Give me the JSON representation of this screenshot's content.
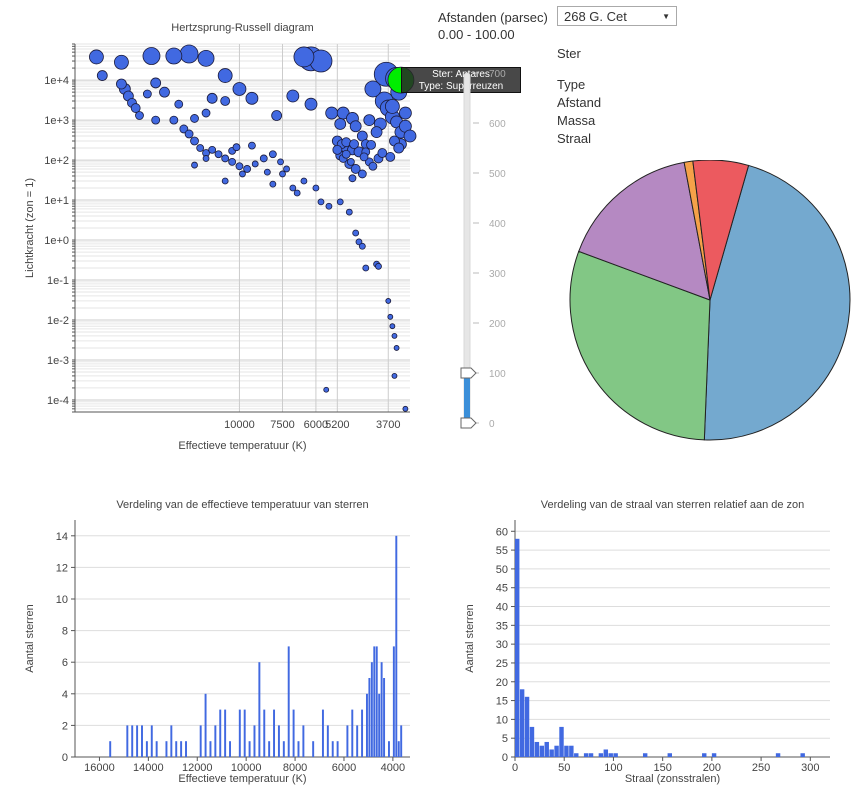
{
  "hr": {
    "title": "Hertzsprung-Russell diagram",
    "xlabel": "Effectieve temperatuur (K)",
    "ylabel": "Lichtkracht (zon = 1)",
    "xticks": [
      "10000",
      "7500",
      "6000",
      "5200",
      "3700"
    ],
    "yticks": [
      "1e+4",
      "1e+3",
      "1e+2",
      "1e+1",
      "1e+0",
      "1e-1",
      "1e-2",
      "1e-3",
      "1e-4"
    ],
    "tooltip": {
      "line1": "Ster: Antares",
      "line2": "Type: Superreuzen"
    },
    "highlight_color": "#00ee00",
    "point_color": "#4169e1"
  },
  "controls": {
    "distance_label": "Afstanden (parsec)",
    "distance_range": "0.00 - 100.00",
    "select_value": "268 G. Cet",
    "slider_ticks": [
      "700",
      "600",
      "500",
      "400",
      "300",
      "200",
      "100",
      "0"
    ],
    "range": [
      0,
      100
    ]
  },
  "info": {
    "star_label": "Ster",
    "type_label": "Type",
    "distance_label": "Afstand",
    "mass_label": "Massa",
    "radius_label": "Straal"
  },
  "chart_data": [
    {
      "type": "scatter",
      "title": "Hertzsprung-Russell diagram",
      "xlabel": "Effectieve temperatuur (K)",
      "ylabel": "Lichtkracht (zon = 1)",
      "scale": "log-log",
      "xlim": [
        30000,
        3200
      ],
      "ylim": [
        5e-05,
        80000
      ],
      "points": [
        [
          25000,
          13000,
          5
        ],
        [
          22000,
          8000,
          5
        ],
        [
          21000,
          4000,
          5
        ],
        [
          20500,
          2700,
          4.5
        ],
        [
          20000,
          2000,
          4.5
        ],
        [
          21500,
          6000,
          5.5
        ],
        [
          18500,
          4500,
          4
        ],
        [
          17500,
          8500,
          5
        ],
        [
          16500,
          5000,
          5
        ],
        [
          19500,
          1300,
          4
        ],
        [
          17500,
          1000,
          4
        ],
        [
          15500,
          1000,
          4
        ],
        [
          15000,
          2500,
          4
        ],
        [
          13500,
          1100,
          4
        ],
        [
          12500,
          1500,
          4
        ],
        [
          12000,
          3500,
          5
        ],
        [
          11000,
          3000,
          4.5
        ],
        [
          14500,
          600,
          4
        ],
        [
          14000,
          450,
          4
        ],
        [
          13500,
          300,
          4
        ],
        [
          13000,
          200,
          3.5
        ],
        [
          12500,
          150,
          3.5
        ],
        [
          12000,
          180,
          3.5
        ],
        [
          11500,
          140,
          3.5
        ],
        [
          11000,
          110,
          3.5
        ],
        [
          10500,
          90,
          3.5
        ],
        [
          10000,
          70,
          3.5
        ],
        [
          10500,
          170,
          3.5
        ],
        [
          9500,
          60,
          3.5
        ],
        [
          9000,
          80,
          3
        ],
        [
          8500,
          110,
          3.5
        ],
        [
          8300,
          50,
          3
        ],
        [
          8000,
          25,
          3
        ],
        [
          7500,
          45,
          3
        ],
        [
          7000,
          20,
          3
        ],
        [
          6800,
          15,
          3
        ],
        [
          9800,
          45,
          3
        ],
        [
          11000,
          30,
          3
        ],
        [
          12500,
          110,
          3
        ],
        [
          13500,
          75,
          3
        ],
        [
          10200,
          210,
          3.5
        ],
        [
          9200,
          230,
          3.5
        ],
        [
          8000,
          140,
          3.5
        ],
        [
          7600,
          90,
          3
        ],
        [
          7300,
          60,
          3
        ],
        [
          6500,
          30,
          3
        ],
        [
          6000,
          20,
          3
        ],
        [
          5800,
          9,
          3
        ],
        [
          5500,
          7,
          3
        ],
        [
          5100,
          9,
          3
        ],
        [
          4800,
          5,
          3
        ],
        [
          4600,
          1.5,
          3
        ],
        [
          4500,
          0.9,
          3
        ],
        [
          4400,
          0.7,
          3
        ],
        [
          4300,
          0.2,
          3
        ],
        [
          4000,
          0.25,
          3
        ],
        [
          3950,
          0.22,
          3
        ],
        [
          3700,
          0.03,
          2.5
        ],
        [
          3650,
          0.012,
          2.5
        ],
        [
          3600,
          0.007,
          2.5
        ],
        [
          3550,
          0.004,
          2.5
        ],
        [
          3500,
          0.002,
          2.5
        ],
        [
          3550,
          0.0004,
          2.5
        ],
        [
          3300,
          6e-05,
          2.5
        ],
        [
          5600,
          0.00018,
          2.5
        ],
        [
          26000,
          38000,
          7
        ],
        [
          22000,
          28000,
          7
        ],
        [
          18000,
          40000,
          8.5
        ],
        [
          14000,
          45000,
          9
        ],
        [
          15500,
          40000,
          8
        ],
        [
          12500,
          35000,
          8
        ],
        [
          11000,
          13000,
          7
        ],
        [
          10000,
          6000,
          6.5
        ],
        [
          9200,
          3500,
          6
        ],
        [
          7800,
          1300,
          5
        ],
        [
          7000,
          4000,
          6
        ],
        [
          6200,
          2500,
          6
        ],
        [
          6500,
          38000,
          10
        ],
        [
          6200,
          34000,
          12
        ],
        [
          5800,
          30000,
          11
        ],
        [
          5400,
          1500,
          6
        ],
        [
          5100,
          800,
          5.5
        ],
        [
          5000,
          1500,
          6
        ],
        [
          4700,
          1100,
          6
        ],
        [
          4600,
          700,
          5.5
        ],
        [
          4400,
          400,
          5
        ],
        [
          4200,
          1000,
          5.5
        ],
        [
          4000,
          500,
          5.5
        ],
        [
          3900,
          800,
          6
        ],
        [
          4100,
          6000,
          8
        ],
        [
          3800,
          3000,
          9
        ],
        [
          3700,
          2000,
          8
        ],
        [
          3600,
          1200,
          7
        ],
        [
          3500,
          900,
          6
        ],
        [
          3400,
          500,
          6
        ],
        [
          3300,
          700,
          6
        ],
        [
          3750,
          14000,
          12
        ],
        [
          3500,
          11000,
          11
        ],
        [
          3450,
          5000,
          8
        ],
        [
          3600,
          2200,
          7
        ],
        [
          3300,
          1500,
          6
        ],
        [
          3200,
          400,
          6
        ],
        [
          3400,
          250,
          5.5
        ],
        [
          4900,
          200,
          5
        ],
        [
          4700,
          180,
          5
        ],
        [
          4500,
          160,
          5
        ],
        [
          5100,
          130,
          4.5
        ],
        [
          4800,
          80,
          4.5
        ],
        [
          4600,
          60,
          4.5
        ],
        [
          4400,
          45,
          4
        ],
        [
          4200,
          90,
          4
        ],
        [
          4100,
          70,
          4
        ],
        [
          3950,
          110,
          4.5
        ],
        [
          3850,
          150,
          4.5
        ],
        [
          3650,
          120,
          4.5
        ],
        [
          3550,
          300,
          5
        ],
        [
          3450,
          200,
          5
        ],
        [
          5200,
          300,
          5
        ],
        [
          5050,
          250,
          4.5
        ],
        [
          4900,
          280,
          4.5
        ],
        [
          5200,
          180,
          4.5
        ],
        [
          4650,
          250,
          4.5
        ],
        [
          4300,
          250,
          4.5
        ],
        [
          4150,
          240,
          4.5
        ],
        [
          5000,
          110,
          4
        ],
        [
          4300,
          160,
          4
        ],
        [
          4350,
          120,
          4
        ],
        [
          4700,
          35,
          3.5
        ],
        [
          4750,
          90,
          3.5
        ],
        [
          4900,
          140,
          4
        ]
      ],
      "highlight": {
        "x": 3400,
        "y": 10000,
        "r": 13,
        "label": "Antares"
      }
    },
    {
      "type": "pie",
      "slices": [
        {
          "label": "",
          "value": 46.2,
          "color": "#74a9cf"
        },
        {
          "label": "",
          "value": 30.0,
          "color": "#82c785"
        },
        {
          "label": "",
          "value": 16.4,
          "color": "#b589c2"
        },
        {
          "label": "",
          "value": 1.0,
          "color": "#f5a149"
        },
        {
          "label": "",
          "value": 6.4,
          "color": "#ec5a5f"
        }
      ]
    },
    {
      "type": "bar",
      "title": "Verdeling van de effectieve temperatuur van sterren",
      "xlabel": "Effectieve temperatuur (K)",
      "ylabel": "Aantal sterren",
      "xlim": [
        17000,
        3300
      ],
      "ylim": [
        0,
        15
      ],
      "xticks": [
        16000,
        14000,
        12000,
        10000,
        8000,
        6000,
        4000
      ],
      "yticks": [
        0,
        2,
        4,
        6,
        8,
        10,
        12,
        14
      ],
      "bins": [
        [
          15600,
          1
        ],
        [
          14900,
          2
        ],
        [
          14700,
          2
        ],
        [
          14500,
          2
        ],
        [
          14300,
          2
        ],
        [
          14100,
          1
        ],
        [
          13900,
          2
        ],
        [
          13700,
          1
        ],
        [
          13300,
          1
        ],
        [
          13100,
          2
        ],
        [
          12900,
          1
        ],
        [
          12700,
          1
        ],
        [
          12500,
          1
        ],
        [
          11900,
          2
        ],
        [
          11700,
          4
        ],
        [
          11500,
          1
        ],
        [
          11300,
          2
        ],
        [
          11100,
          3
        ],
        [
          10900,
          3
        ],
        [
          10700,
          1
        ],
        [
          10300,
          3
        ],
        [
          10100,
          3
        ],
        [
          9900,
          1
        ],
        [
          9700,
          2
        ],
        [
          9500,
          6
        ],
        [
          9300,
          3
        ],
        [
          9100,
          1
        ],
        [
          8900,
          3
        ],
        [
          8700,
          2
        ],
        [
          8500,
          1
        ],
        [
          8300,
          7
        ],
        [
          8100,
          3
        ],
        [
          7900,
          1
        ],
        [
          7700,
          2
        ],
        [
          7300,
          1
        ],
        [
          6900,
          3
        ],
        [
          6700,
          2
        ],
        [
          6500,
          1
        ],
        [
          6300,
          1
        ],
        [
          5900,
          2
        ],
        [
          5700,
          3
        ],
        [
          5500,
          2
        ],
        [
          5300,
          3
        ],
        [
          5100,
          4
        ],
        [
          5000,
          5
        ],
        [
          4900,
          6
        ],
        [
          4800,
          7
        ],
        [
          4700,
          7
        ],
        [
          4600,
          4
        ],
        [
          4500,
          6
        ],
        [
          4400,
          5
        ],
        [
          4200,
          1
        ],
        [
          4000,
          7
        ],
        [
          3900,
          14
        ],
        [
          3800,
          1
        ],
        [
          3700,
          2
        ]
      ]
    },
    {
      "type": "bar",
      "title": "Verdeling van de straal van sterren relatief aan de zon",
      "xlabel": "Straal (zonsstralen)",
      "ylabel": "Aantal sterren",
      "xlim": [
        0,
        320
      ],
      "ylim": [
        0,
        63
      ],
      "xticks": [
        0,
        50,
        100,
        150,
        200,
        250,
        300
      ],
      "yticks": [
        0,
        5,
        10,
        15,
        20,
        25,
        30,
        35,
        40,
        45,
        50,
        55,
        60
      ],
      "bins": [
        [
          0,
          58
        ],
        [
          5,
          18
        ],
        [
          10,
          16
        ],
        [
          15,
          8
        ],
        [
          20,
          4
        ],
        [
          25,
          3
        ],
        [
          30,
          4
        ],
        [
          35,
          2
        ],
        [
          40,
          3
        ],
        [
          45,
          8
        ],
        [
          50,
          3
        ],
        [
          55,
          3
        ],
        [
          60,
          1
        ],
        [
          70,
          1
        ],
        [
          75,
          1
        ],
        [
          85,
          1
        ],
        [
          90,
          2
        ],
        [
          95,
          1
        ],
        [
          100,
          1
        ],
        [
          130,
          1
        ],
        [
          155,
          1
        ],
        [
          190,
          1
        ],
        [
          200,
          1
        ],
        [
          265,
          1
        ],
        [
          290,
          1
        ]
      ]
    }
  ]
}
